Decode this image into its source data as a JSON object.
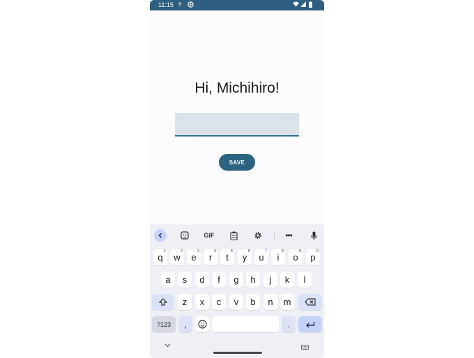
{
  "status_bar": {
    "time": "11:15"
  },
  "greeting": "Hi, Michihiro!",
  "text_field": {
    "value": ""
  },
  "save_button": {
    "label": "SAVE"
  },
  "keyboard": {
    "toolbar": {
      "gif_label": "GIF"
    },
    "row1": [
      {
        "key": "q",
        "hint": "1"
      },
      {
        "key": "w",
        "hint": "2"
      },
      {
        "key": "e",
        "hint": "3"
      },
      {
        "key": "r",
        "hint": "4"
      },
      {
        "key": "t",
        "hint": "5"
      },
      {
        "key": "y",
        "hint": "6"
      },
      {
        "key": "u",
        "hint": "7"
      },
      {
        "key": "i",
        "hint": "8"
      },
      {
        "key": "o",
        "hint": "9"
      },
      {
        "key": "p",
        "hint": "0"
      }
    ],
    "row2": [
      "a",
      "s",
      "d",
      "f",
      "g",
      "h",
      "j",
      "k",
      "l"
    ],
    "row3": [
      "z",
      "x",
      "c",
      "v",
      "b",
      "n",
      "m"
    ],
    "row4": {
      "symbols": "?123",
      "comma": ",",
      "period": "."
    }
  }
}
